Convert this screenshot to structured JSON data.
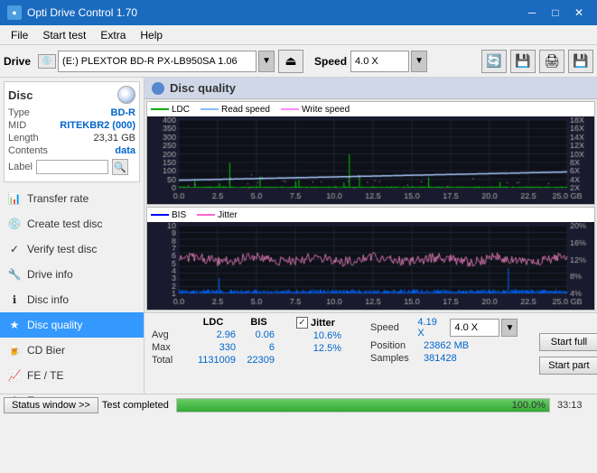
{
  "app": {
    "title": "Opti Drive Control 1.70",
    "icon": "●"
  },
  "titlebar": {
    "minimize": "─",
    "maximize": "□",
    "close": "✕"
  },
  "menu": {
    "items": [
      "File",
      "Start test",
      "Extra",
      "Help"
    ]
  },
  "toolbar": {
    "drive_label": "Drive",
    "drive_value": "(E:)  PLEXTOR BD-R  PX-LB950SA 1.06",
    "speed_label": "Speed",
    "speed_value": "4.0 X"
  },
  "disc": {
    "title": "Disc",
    "type_label": "Type",
    "type_value": "BD-R",
    "mid_label": "MID",
    "mid_value": "RITEKBR2 (000)",
    "length_label": "Length",
    "length_value": "23,31 GB",
    "contents_label": "Contents",
    "contents_value": "data",
    "label_label": "Label"
  },
  "nav": {
    "items": [
      {
        "id": "transfer-rate",
        "label": "Transfer rate",
        "icon": "📊"
      },
      {
        "id": "create-test-disc",
        "label": "Create test disc",
        "icon": "💿"
      },
      {
        "id": "verify-test-disc",
        "label": "Verify test disc",
        "icon": "✓"
      },
      {
        "id": "drive-info",
        "label": "Drive info",
        "icon": "🔧"
      },
      {
        "id": "disc-info",
        "label": "Disc info",
        "icon": "ℹ"
      },
      {
        "id": "disc-quality",
        "label": "Disc quality",
        "icon": "★",
        "active": true
      },
      {
        "id": "cd-bier",
        "label": "CD Bier",
        "icon": "🍺"
      },
      {
        "id": "fe-te",
        "label": "FE / TE",
        "icon": "📈"
      },
      {
        "id": "extra-tests",
        "label": "Extra tests",
        "icon": "⚙"
      }
    ]
  },
  "chart_top": {
    "title": "Disc quality",
    "legend": [
      {
        "label": "LDC",
        "color": "#00aa00"
      },
      {
        "label": "Read speed",
        "color": "#88bbff"
      },
      {
        "label": "Write speed",
        "color": "#ff88ff"
      }
    ],
    "y_axis_left": [
      "400",
      "350",
      "300",
      "250",
      "200",
      "150",
      "100",
      "50",
      "0"
    ],
    "y_axis_right": [
      "18X",
      "16X",
      "14X",
      "12X",
      "10X",
      "8X",
      "6X",
      "4X",
      "2X"
    ],
    "x_axis": [
      "0.0",
      "2.5",
      "5.0",
      "7.5",
      "10.0",
      "12.5",
      "15.0",
      "17.5",
      "20.0",
      "22.5",
      "25.0 GB"
    ]
  },
  "chart_bottom": {
    "legend": [
      {
        "label": "BIS",
        "color": "#0000ff"
      },
      {
        "label": "Jitter",
        "color": "#ff66cc"
      }
    ],
    "y_axis_left": [
      "10",
      "9",
      "8",
      "7",
      "6",
      "5",
      "4",
      "3",
      "2",
      "1"
    ],
    "y_axis_right": [
      "20%",
      "16%",
      "12%",
      "8%",
      "4%"
    ],
    "x_axis": [
      "0.0",
      "2.5",
      "5.0",
      "7.5",
      "10.0",
      "12.5",
      "15.0",
      "17.5",
      "20.0",
      "22.5",
      "25.0 GB"
    ]
  },
  "stats": {
    "ldc_header": "LDC",
    "bis_header": "BIS",
    "jitter_header": "Jitter",
    "avg_label": "Avg",
    "max_label": "Max",
    "total_label": "Total",
    "ldc_avg": "2.96",
    "ldc_max": "330",
    "ldc_total": "1131009",
    "bis_avg": "0.06",
    "bis_max": "6",
    "bis_total": "22309",
    "jitter_avg": "10.6%",
    "jitter_max": "12.5%",
    "jitter_checkbox": "✓",
    "speed_label": "Speed",
    "speed_value": "4.19 X",
    "speed_select": "4.0 X",
    "position_label": "Position",
    "position_value": "23862 MB",
    "samples_label": "Samples",
    "samples_value": "381428",
    "btn_start_full": "Start full",
    "btn_start_part": "Start part"
  },
  "statusbar": {
    "status_btn": "Status window >>",
    "status_text": "Test completed",
    "progress": "100.0%",
    "time": "33:13"
  },
  "colors": {
    "ldc_bar": "#00cc00",
    "bis_bar": "#0000ff",
    "read_speed": "#88bbff",
    "jitter_line": "#ff66cc",
    "active_nav": "#3399ff",
    "progress_green": "#33aa33",
    "accent_blue": "#0066cc"
  }
}
